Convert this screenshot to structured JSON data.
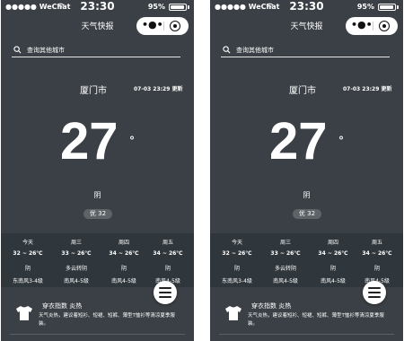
{
  "status_bar": {
    "carrier": "●●●●● WeChat",
    "wifi_icon": "wifi-icon",
    "time": "23:30",
    "battery_text": "95%",
    "battery_level": 0.95
  },
  "nav": {
    "title": "天气快报",
    "more_icon": "more-dots-icon",
    "more_glyph": "•●•",
    "close_icon": "target-circle-icon"
  },
  "search": {
    "placeholder": "查询其他城市",
    "icon": "search-icon"
  },
  "current": {
    "city": "厦门市",
    "updated": "07-03 23:29 更新",
    "temperature": "27",
    "unit": "°",
    "weather": "阴",
    "aqi": "优 32"
  },
  "forecast": [
    {
      "day": "今天",
      "temp": "32 ~ 26℃",
      "weather": "阴",
      "wind": "东南风3-4级"
    },
    {
      "day": "周三",
      "temp": "33 ~ 26℃",
      "weather": "多云转阴",
      "wind": "南风4-5级"
    },
    {
      "day": "周四",
      "temp": "34 ~ 26℃",
      "weather": "阴",
      "wind": "南风4-5级"
    },
    {
      "day": "周五",
      "temp": "34 ~ 26℃",
      "weather": "阴",
      "wind": "南风4-5级"
    }
  ],
  "menu_icon": "hamburger-menu-icon",
  "lifestyle": {
    "icon": "tshirt-icon",
    "title": "穿衣指数 炎热",
    "description": "天气炎热，建议着短衫、短裙、短裤、薄型T恤衫等清凉夏季服装。"
  },
  "colors": {
    "background": "#3a4045",
    "forecast_background": "#30373c",
    "text": "#ffffff",
    "badge": "#5d6367"
  }
}
